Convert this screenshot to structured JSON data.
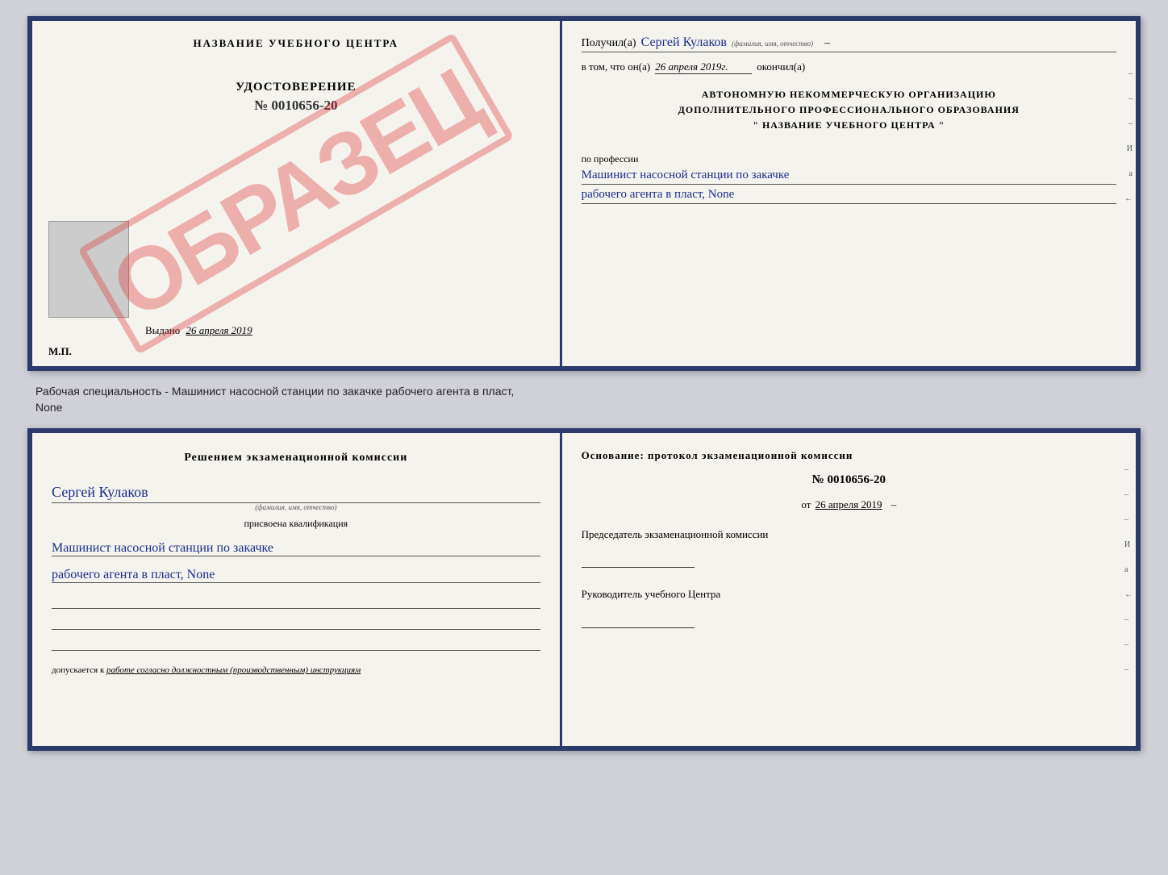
{
  "topDoc": {
    "left": {
      "centerTitle": "НАЗВАНИЕ УЧЕБНОГО ЦЕНТРА",
      "stampText": "ОБРАЗЕЦ",
      "udostoverenie": "УДОСТОВЕРЕНИЕ",
      "number": "№ 0010656-20",
      "vydano": "Выдано",
      "vydanoDate": "26 апреля 2019",
      "mp": "М.П."
    },
    "right": {
      "poluchilLabel": "Получил(a)",
      "poluchilName": "Сергей Кулаков",
      "familiyaLabel": "(фамилия, имя, отчество)",
      "dash": "–",
      "vtomLabel": "в том, что он(а)",
      "vtomDate": "26 апреля 2019г.",
      "okonchilLabel": "окончил(а)",
      "orgLine1": "АВТОНОМНУЮ НЕКОММЕРЧЕСКУЮ ОРГАНИЗАЦИЮ",
      "orgLine2": "ДОПОЛНИТЕЛЬНОГО ПРОФЕССИОНАЛЬНОГО ОБРАЗОВАНИЯ",
      "orgLine3": "\"   НАЗВАНИЕ УЧЕБНОГО ЦЕНТРА   \"",
      "poProf": "по профессии",
      "prof1": "Машинист насосной станции по закачке",
      "prof2": "рабочего агента в пласт, None",
      "sideDashes": [
        "-",
        "-",
        "-",
        "И",
        "а",
        "←"
      ]
    }
  },
  "separatorText": "Рабочая специальность - Машинист насосной станции по закачке рабочего агента в пласт,",
  "separatorText2": "None",
  "bottomDoc": {
    "left": {
      "reshenieTitle": "Решением экзаменационной комиссии",
      "name": "Сергей Кулаков",
      "familiyaLabel": "(фамилия, имя, отчество)",
      "prisvoena": "присвоена квалификация",
      "qual1": "Машинист насосной станции по закачке",
      "qual2": "рабочего агента в пласт, None",
      "dopuskaetsyaLabel": "допускается к",
      "dopuskaetsyaVal": "работе согласно должностным (производственным) инструкциям"
    },
    "right": {
      "osnovanie": "Основание: протокол экзаменационной комиссии",
      "protocolNum": "№ 0010656-20",
      "otLabel": "от",
      "date": "26 апреля 2019",
      "predsedatelLabel": "Председатель экзаменационной комиссии",
      "rukovoditelLabel": "Руководитель учебного Центра",
      "sideDashes": [
        "-",
        "-",
        "-",
        "И",
        "а",
        "←",
        "-",
        "-",
        "-"
      ]
    }
  }
}
